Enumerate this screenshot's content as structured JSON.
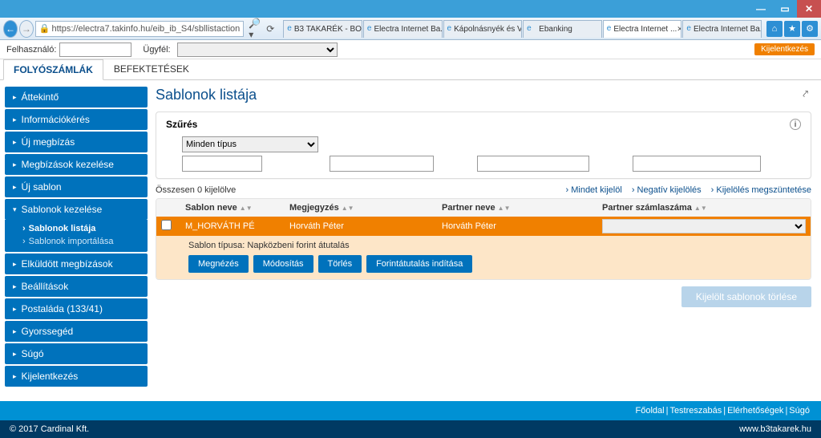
{
  "browser": {
    "url": "https://electra7.takinfo.hu/eib_ib_S4/sbllistaction",
    "tabs": [
      {
        "label": "B3 TAKARÉK - BO..."
      },
      {
        "label": "Electra Internet Ba..."
      },
      {
        "label": "Kápolnásnyék és V..."
      },
      {
        "label": "Ebanking"
      },
      {
        "label": "Electra Internet ...",
        "active": true
      },
      {
        "label": "Electra Internet Ba..."
      }
    ]
  },
  "header": {
    "user_label": "Felhasználó:",
    "client_label": "Ügyfél:",
    "logout": "Kijelentkezés"
  },
  "maintabs": {
    "active": "FOLYÓSZÁMLÁK",
    "other": "BEFEKTETÉSEK"
  },
  "sidebar": {
    "items": [
      {
        "label": "Áttekintő"
      },
      {
        "label": "Információkérés"
      },
      {
        "label": "Új megbízás"
      },
      {
        "label": "Megbízások kezelése"
      },
      {
        "label": "Új sablon"
      },
      {
        "label": "Sablonok kezelése",
        "expanded": true,
        "subs": [
          {
            "label": "Sablonok listája",
            "active": true
          },
          {
            "label": "Sablonok importálása"
          }
        ]
      },
      {
        "label": "Elküldött megbízások"
      },
      {
        "label": "Beállítások"
      },
      {
        "label": "Postaláda (133/41)"
      },
      {
        "label": "Gyorssegéd"
      },
      {
        "label": "Súgó"
      },
      {
        "label": "Kijelentkezés"
      }
    ]
  },
  "page": {
    "title": "Sablonok listája",
    "filter": {
      "heading": "Szűrés",
      "type_select": "Minden típus"
    },
    "list": {
      "summary": "Összesen 0 kijelölve",
      "links": {
        "all": "Mindet kijelöl",
        "neg": "Negatív kijelölés",
        "clear": "Kijelölés megszüntetése"
      },
      "cols": {
        "c1": "Sablon neve",
        "c2": "Megjegyzés",
        "c3": "Partner neve",
        "c4": "Partner számlaszáma"
      },
      "row": {
        "c1": "M_HORVÁTH PÉ",
        "c2": "Horváth Péter",
        "c3": "Horváth Péter"
      },
      "detail": {
        "type_label": "Sablon típusa:",
        "type_value": "Napközbeni forint átutalás",
        "btn_view": "Megnézés",
        "btn_edit": "Módosítás",
        "btn_del": "Törlés",
        "btn_start": "Forintátutalás indítása"
      },
      "delete_selected": "Kijelölt sablonok törlése"
    }
  },
  "footer": {
    "links": {
      "home": "Főoldal",
      "custom": "Testreszabás",
      "contact": "Elérhetőségek",
      "help": "Súgó"
    },
    "copyright": "© 2017 Cardinal Kft.",
    "site": "www.b3takarek.hu"
  }
}
